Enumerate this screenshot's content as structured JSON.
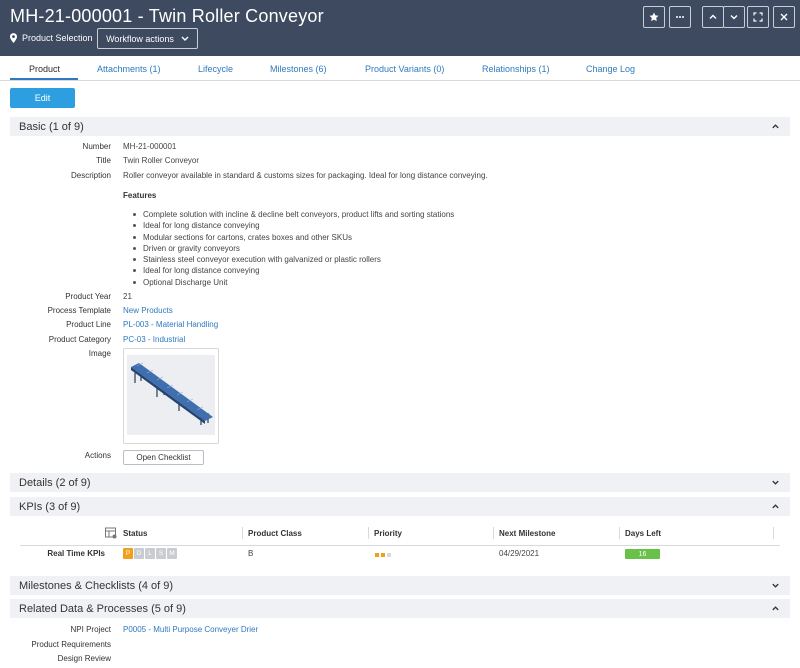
{
  "header": {
    "title": "MH-21-000001 - Twin Roller Conveyor",
    "location": "Product Selection",
    "workflow_label": "Workflow actions"
  },
  "tabs": [
    {
      "label": "Product",
      "active": true
    },
    {
      "label": "Attachments (1)"
    },
    {
      "label": "Lifecycle"
    },
    {
      "label": "Milestones (6)"
    },
    {
      "label": "Product Variants (0)"
    },
    {
      "label": "Relationships (1)"
    },
    {
      "label": "Change Log"
    }
  ],
  "edit_label": "Edit",
  "sections": {
    "basic": "Basic (1 of 9)",
    "details": "Details (2 of 9)",
    "kpis": "KPIs (3 of 9)",
    "milestones": "Milestones & Checklists (4 of 9)",
    "related": "Related Data & Processes (5 of 9)"
  },
  "basic": {
    "number_label": "Number",
    "number": "MH-21-000001",
    "title_label": "Title",
    "title": "Twin Roller Conveyor",
    "description_label": "Description",
    "description": "Roller conveyor available in standard & customs sizes for packaging. Ideal for long distance conveying.",
    "features_heading": "Features",
    "features": [
      "Complete solution with incline & decline belt conveyors, product lifts and sorting stations",
      "Ideal for long distance conveying",
      "Modular sections for cartons, crates boxes and other SKUs",
      "Driven or gravity conveyors",
      "Stainless steel conveyor execution with galvanized or plastic rollers",
      "Ideal for long distance conveying",
      "Optional Discharge Unit"
    ],
    "year_label": "Product Year",
    "year": "21",
    "template_label": "Process Template",
    "template": "New Products",
    "line_label": "Product Line",
    "line": "PL-003 - Material Handling",
    "category_label": "Product Category",
    "category": "PC-03 - Industrial",
    "image_label": "Image",
    "actions_label": "Actions",
    "checklist_label": "Open Checklist"
  },
  "kpis": {
    "columns": [
      "Status",
      "Product Class",
      "Priority",
      "Next Milestone",
      "Days Left"
    ],
    "row_label": "Real Time KPIs",
    "status_letters": [
      "P",
      "D",
      "L",
      "S",
      "M"
    ],
    "status_active_count": 1,
    "product_class": "B",
    "priority_level": 2,
    "priority_max": 3,
    "next_milestone": "04/29/2021",
    "days_left": "16"
  },
  "related": {
    "npi_label": "NPI Project",
    "npi": "P0005 - Multi Purpose Conveyer Drier",
    "requirements_label": "Product Requirements",
    "design_label": "Design Review"
  },
  "colors": {
    "header_bg": "#3d4a5f",
    "accent": "#2f7abf",
    "edit_button": "#2d9fe0",
    "status_on": "#f0a01c",
    "days_left": "#68c24a"
  }
}
